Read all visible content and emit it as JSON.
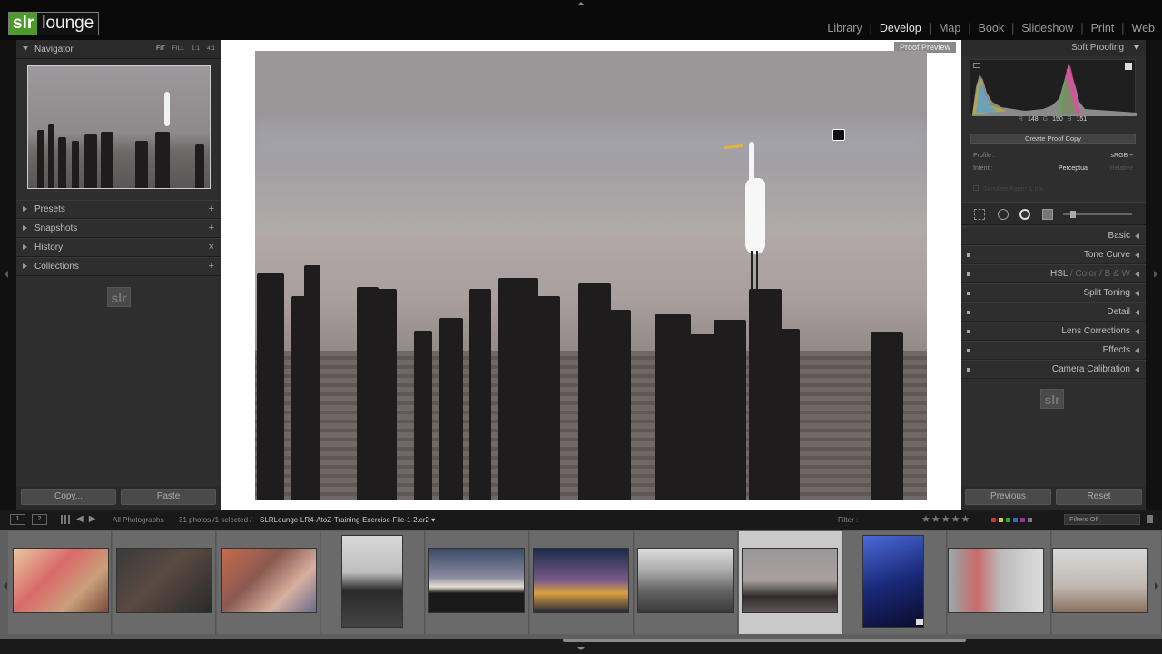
{
  "logo": {
    "part1": "slr",
    "part2": "lounge"
  },
  "modules": [
    {
      "label": "Library",
      "active": false
    },
    {
      "label": "Develop",
      "active": true
    },
    {
      "label": "Map",
      "active": false
    },
    {
      "label": "Book",
      "active": false
    },
    {
      "label": "Slideshow",
      "active": false
    },
    {
      "label": "Print",
      "active": false
    },
    {
      "label": "Web",
      "active": false
    }
  ],
  "left_panel": {
    "navigator": {
      "title": "Navigator",
      "options": [
        "FIT",
        "FILL",
        "1:1",
        "4:1"
      ]
    },
    "sections": [
      {
        "label": "Presets",
        "action": "+"
      },
      {
        "label": "Snapshots",
        "action": "+"
      },
      {
        "label": "History",
        "action": "×"
      },
      {
        "label": "Collections",
        "action": "+"
      }
    ],
    "watermark": "slr",
    "copy_button": "Copy...",
    "paste_button": "Paste"
  },
  "center": {
    "proof_label": "Proof Preview"
  },
  "right_panel": {
    "soft_proofing": "Soft Proofing",
    "rgb": {
      "r_label": "R",
      "r": "148",
      "g_label": "G",
      "g": "150",
      "b_label": "B",
      "b": "151"
    },
    "create_proof_copy": "Create Proof Copy",
    "profile_label": "Profile :",
    "profile_value": "sRGB ÷",
    "intent_label": "Intent :",
    "intent_perceptual": "Perceptual",
    "intent_relative": "Relative",
    "simulate": "Simulate Paper & Ink",
    "sections": [
      {
        "label": "Basic"
      },
      {
        "label": "Tone Curve"
      },
      {
        "label": "HSL",
        "extra": [
          "Color",
          "B & W"
        ]
      },
      {
        "label": "Split Toning"
      },
      {
        "label": "Detail"
      },
      {
        "label": "Lens Corrections"
      },
      {
        "label": "Effects"
      },
      {
        "label": "Camera Calibration"
      }
    ],
    "watermark": "slr",
    "previous_button": "Previous",
    "reset_button": "Reset"
  },
  "filmbar": {
    "view1": "1",
    "view2": "2",
    "source": "All Photographs",
    "count": "31 photos /1 selected /",
    "filename": "SLRLounge-LR4-AtoZ-Training-Exercise-File-1-2.cr2 ▾",
    "filter_label": "Filter :",
    "stars": "★★★★★",
    "filters_off": "Filters Off"
  },
  "colors": {
    "accent": "#4c9a2a",
    "panel": "#2e2e2e",
    "selected_cell": "#c9c9c9"
  }
}
